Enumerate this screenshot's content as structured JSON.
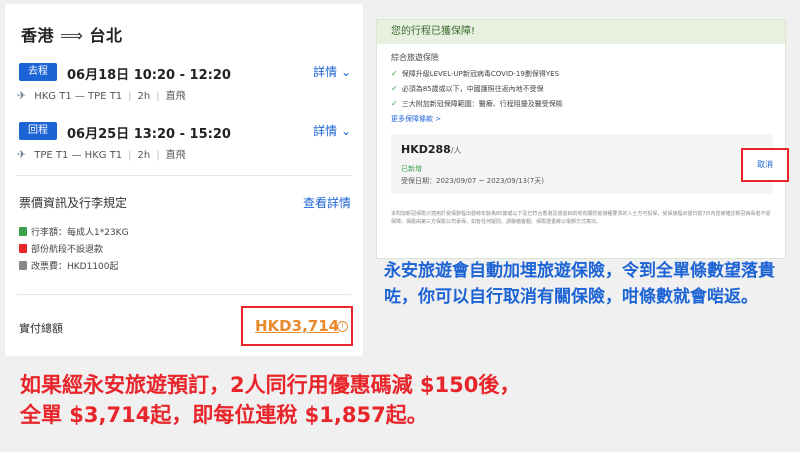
{
  "flight": {
    "route_from": "香港",
    "route_to": "台北",
    "outbound": {
      "badge": "去程",
      "datetime": "06月18日 10:20 - 12:20",
      "detail": "詳情",
      "route": "HKG T1 — TPE T1",
      "duration": "2h",
      "type": "直飛"
    },
    "return": {
      "badge": "回程",
      "datetime": "06月25日 13:20 - 15:20",
      "detail": "詳情",
      "route": "TPE T1 — HKG T1",
      "duration": "2h",
      "type": "直飛"
    }
  },
  "fare": {
    "title": "票價資訊及行李規定",
    "link": "查看詳情",
    "luggage": "行李額：每成人1*23KG",
    "refund": "部份航段不設退款",
    "change": "改票費：HKD1100起"
  },
  "total": {
    "label": "實付總額",
    "price": "HKD3,714",
    "info_icon": "!"
  },
  "insurance": {
    "header": "您的行程已獲保障!",
    "subtitle": "綜合旅遊保險",
    "items": [
      "保障升級LEVEL-UP新冠病毒COVID-19劃保得YES",
      "必須為85歲或以下，中國護照往返內地不受保",
      "三大附加新冠保障範圍：醫療、行程阻擾及醫受保險"
    ],
    "more": "更多保障條款 >",
    "price": "HKD288",
    "per": "/人",
    "added": "已新增",
    "dates": "受保日期：2023/09/07 ~ 2023/09/13(7天)",
    "cancel": "取消",
    "fine_print": "本附加新冠保險只適用於受保旅程出發時年齡為85歲或以下及已符合香港及旅遊目的地有關防疫接種要求的人士方可投保，受保旅程出發日前7日內曾被確診新冠病毒者不受保障。保險由第三方保險公司承保，如有任何疑問，請聯絡客服。保險證書將以電郵方式寄出。"
  },
  "annotations": {
    "blue": "永安旅遊會自動加埋旅遊保險，令到全單條數望落貴咗，你可以自行取消有關保險，咁條數就會啱返。",
    "red_line1": "如果經永安旅遊預訂，2人同行用優惠碼減 $150後，",
    "red_line2": "全單 $3,714起，即每位連稅 $1,857起。"
  },
  "colors": {
    "accent_blue": "#1c63d5",
    "highlight_red": "#e8252a",
    "price_orange": "#e98a2d",
    "insured_green": "#3aa14a"
  },
  "icons": [
    "plane-icon",
    "chevron-down-icon",
    "luggage-icon",
    "refund-icon",
    "change-icon",
    "info-icon",
    "check-icon"
  ]
}
